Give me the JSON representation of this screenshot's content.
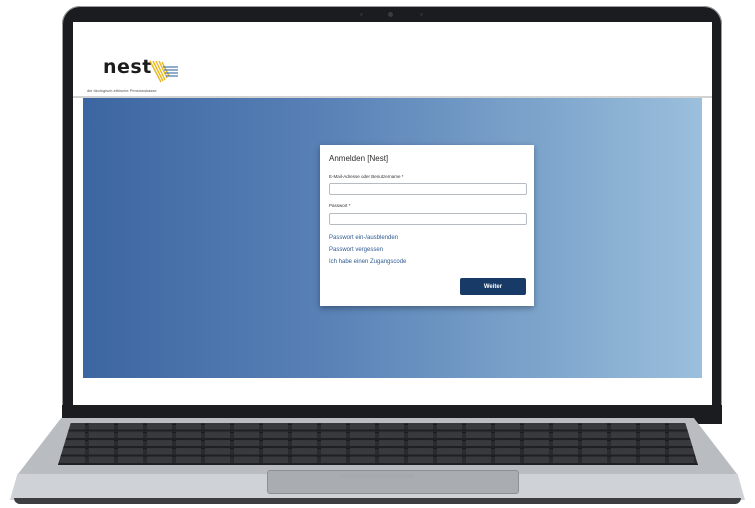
{
  "header": {
    "logo_text": "nest",
    "tagline": "die ökologisch-ethische Pensionskasse"
  },
  "login": {
    "title": "Anmelden [Nest]",
    "username_label": "E-Mail-Adresse oder Benutzername *",
    "username_value": "",
    "password_label": "Passwort *",
    "password_value": "",
    "toggle_password_link": "Passwort ein-/ausblenden",
    "forgot_password_link": "Passwort vergessen",
    "access_code_link": "Ich habe einen Zugangscode",
    "submit_label": "Weiter"
  },
  "colors": {
    "hero_gradient_start": "#3c66a1",
    "hero_gradient_end": "#9bbfdc",
    "primary_button": "#173a66",
    "link": "#2f5b92",
    "logo_accent": "#e8b820"
  }
}
